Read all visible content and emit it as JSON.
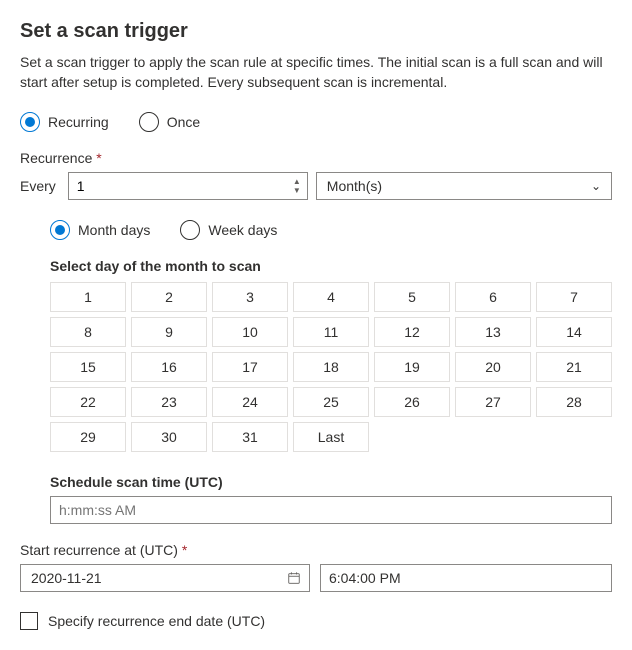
{
  "header": {
    "title": "Set a scan trigger",
    "description": "Set a scan trigger to apply the scan rule at specific times. The initial scan is a full scan and will start after setup is completed. Every subsequent scan is incremental."
  },
  "triggerType": {
    "recurring": "Recurring",
    "once": "Once"
  },
  "recurrence": {
    "label": "Recurrence",
    "everyLabel": "Every",
    "everyValue": "1",
    "unit": "Month(s)"
  },
  "daysMode": {
    "monthDays": "Month days",
    "weekDays": "Week days"
  },
  "monthDays": {
    "label": "Select day of the month to scan",
    "cells": [
      "1",
      "2",
      "3",
      "4",
      "5",
      "6",
      "7",
      "8",
      "9",
      "10",
      "11",
      "12",
      "13",
      "14",
      "15",
      "16",
      "17",
      "18",
      "19",
      "20",
      "21",
      "22",
      "23",
      "24",
      "25",
      "26",
      "27",
      "28",
      "29",
      "30",
      "31",
      "Last"
    ]
  },
  "scheduleTime": {
    "label": "Schedule scan time (UTC)",
    "placeholder": "h:mm:ss AM"
  },
  "startRecurrence": {
    "label": "Start recurrence at (UTC)",
    "date": "2020-11-21",
    "time": "6:04:00 PM"
  },
  "endDate": {
    "label": "Specify recurrence end date (UTC)"
  }
}
